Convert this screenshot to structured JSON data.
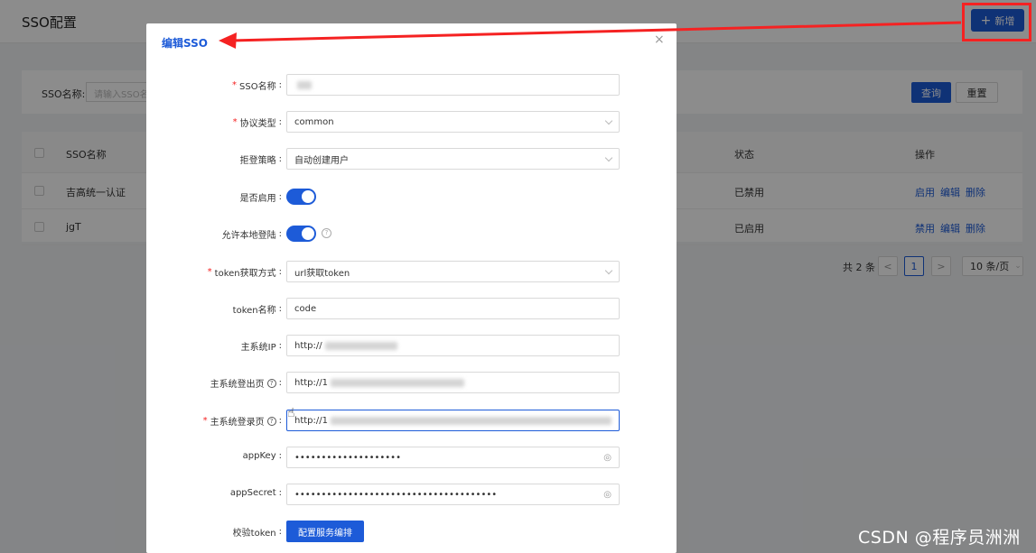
{
  "page": {
    "title": "SSO配置",
    "add_button": "新增",
    "search": {
      "label": "SSO名称:",
      "placeholder": "请输入SSO名",
      "query": "查询",
      "reset": "重置"
    },
    "table": {
      "headers": [
        "SSO名称",
        "状态",
        "操作"
      ],
      "rows": [
        {
          "name": "吉高统一认证",
          "status": "已禁用",
          "actions": [
            "启用",
            "编辑",
            "删除"
          ]
        },
        {
          "name": "jgT",
          "status": "已启用",
          "actions": [
            "禁用",
            "编辑",
            "删除"
          ]
        }
      ]
    },
    "pagination": {
      "total": "共 2 条",
      "current": "1",
      "prev": "<",
      "next": ">",
      "size": "10 条/页"
    }
  },
  "modal": {
    "title": "编辑SSO",
    "close": "×",
    "fields": [
      {
        "label": "SSO名称",
        "required": true,
        "value": ""
      },
      {
        "label": "协议类型",
        "required": true,
        "value": "common"
      },
      {
        "label": "拒登策略",
        "required": false,
        "value": "自动创建用户"
      },
      {
        "label": "是否启用",
        "required": false,
        "value": true
      },
      {
        "label": "允许本地登陆",
        "required": false,
        "value": true
      },
      {
        "label": "token获取方式",
        "required": true,
        "value": "url获取token"
      },
      {
        "label": "token名称",
        "required": false,
        "value": "code"
      },
      {
        "label": "主系统IP",
        "required": false,
        "value": "http://"
      },
      {
        "label": "主系统登出页",
        "required": false,
        "value": "http://1"
      },
      {
        "label": "主系统登录页",
        "required": true,
        "value": "http://1"
      },
      {
        "label": "appKey",
        "required": false,
        "value": "••••••••••••••••••••"
      },
      {
        "label": "appSecret",
        "required": false,
        "value": "••••••••••••••••••••••••••••••••••••••"
      },
      {
        "label": "校验token",
        "required": false,
        "value": "配置服务编排"
      }
    ]
  },
  "watermark": "CSDN @程序员洲洲",
  "colors": {
    "primary": "#1d5bd8",
    "annotation": "#f52222"
  }
}
